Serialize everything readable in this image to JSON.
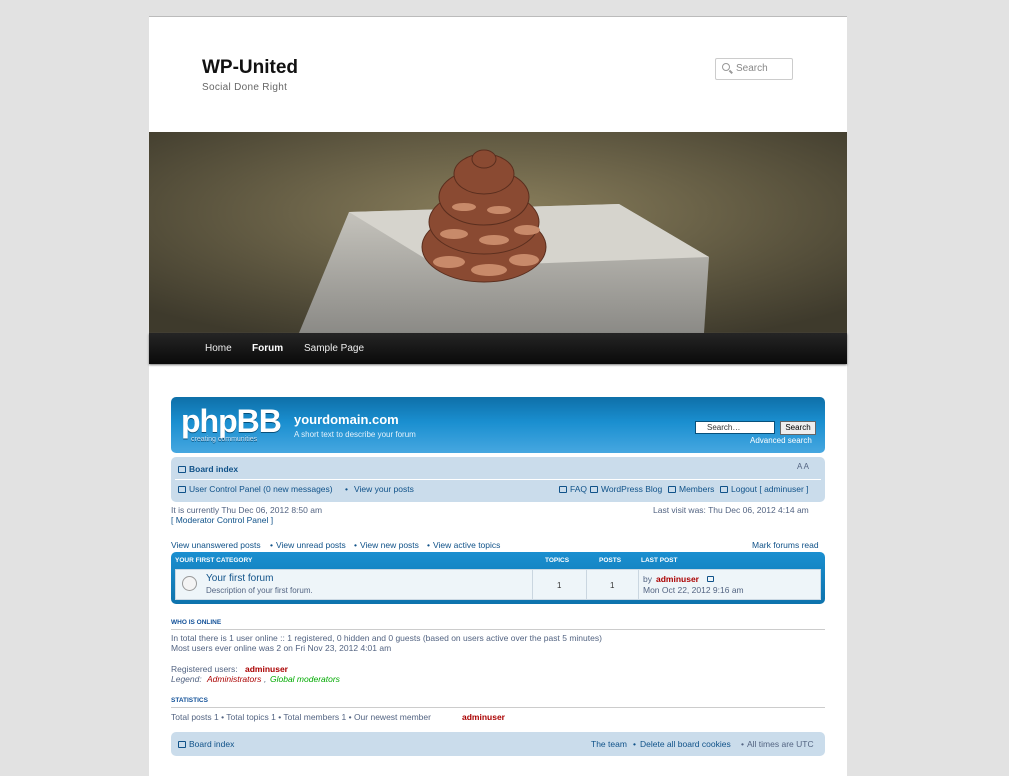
{
  "site": {
    "title": "WP-United",
    "description": "Social Done Right",
    "search_placeholder": "Search"
  },
  "menu": [
    {
      "label": "Home"
    },
    {
      "label": "Forum"
    },
    {
      "label": "Sample Page"
    }
  ],
  "header_image": {
    "description_icon": "pinecone-image"
  },
  "phpbb": {
    "logo_text": "phpBB",
    "logo_sub": "creating communities",
    "board_title": "yourdomain.com",
    "board_desc": "A short text to describe your forum",
    "search_placeholder": "Search…",
    "search_button": "Search",
    "advanced_search": "Advanced search",
    "board_index": "Board index",
    "font_size": "A A",
    "ucp": "User Control Panel (0 new messages)",
    "view_posts": "View your posts",
    "faq": "FAQ",
    "wp_blog": "WordPress Blog",
    "members": "Members",
    "logout": "Logout [ adminuser ]",
    "current_time": "It is currently Thu Dec 06, 2012 8:50 am",
    "mcp": "[ Moderator Control Panel ]",
    "last_visit": "Last visit was: Thu Dec 06, 2012 4:14 am",
    "quick_links": [
      "View unanswered posts",
      "View unread posts",
      "View new posts",
      "View active topics"
    ],
    "mark_read": "Mark forums read",
    "category": {
      "name": "YOUR FIRST CATEGORY",
      "col_topics": "TOPICS",
      "col_posts": "POSTS",
      "col_last": "LAST POST"
    },
    "forum": {
      "name": "Your first forum",
      "desc": "Description of your first forum.",
      "topics": "1",
      "posts": "1",
      "last_by": "by",
      "last_user": "adminuser",
      "last_date": "Mon Oct 22, 2012 9:16 am"
    },
    "online": {
      "heading": "WHO IS ONLINE",
      "line1": "In total there is 1 user online :: 1 registered, 0 hidden and 0 guests (based on users active over the past 5 minutes)",
      "line2": "Most users ever online was 2 on Fri Nov 23, 2012 4:01 am",
      "reg_label": "Registered users:",
      "reg_user": "adminuser",
      "legend_label": "Legend:",
      "legend_admin": "Administrators",
      "legend_sep": ",",
      "legend_mod": "Global moderators"
    },
    "stats": {
      "heading": "STATISTICS",
      "text": "Total posts 1 • Total topics 1 • Total members 1 • Our newest member",
      "newest": "adminuser"
    },
    "footer": {
      "board_index": "Board index",
      "team": "The team",
      "delete_cookies": "Delete all board cookies",
      "times": "All times are UTC"
    }
  }
}
